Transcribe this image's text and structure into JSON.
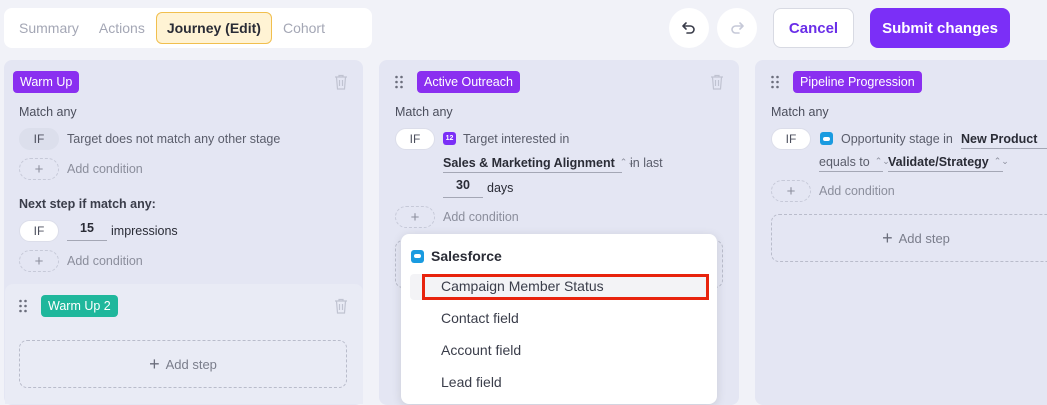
{
  "tabs": [
    "Summary",
    "Actions",
    "Journey (Edit)",
    "Cohort"
  ],
  "header": {
    "cancel": "Cancel",
    "submit": "Submit changes"
  },
  "col1": {
    "stage": "Warm Up",
    "match": "Match any",
    "if": "IF",
    "condition": "Target does not match any other stage",
    "add_condition": "Add condition",
    "next_step": "Next step if match any:",
    "impressions_value": "15",
    "impressions": "impressions",
    "add_condition_2": "Add condition",
    "sub_stage": "Warm Up 2",
    "add_step": "Add step"
  },
  "col2": {
    "stage": "Active Outreach",
    "match": "Match any",
    "if": "IF",
    "icon_text": "12",
    "condition": "Target interested in",
    "topic": "Sales & Marketing Alignment",
    "in_last": "in last",
    "days_value": "30",
    "days": "days",
    "add_condition": "Add condition"
  },
  "col3": {
    "stage": "Pipeline Progression",
    "match": "Match any",
    "if": "IF",
    "condition": "Opportunity stage in",
    "product": "New Product",
    "equals_to": "equals to",
    "value": "Validate/Strategy",
    "add_condition": "Add condition",
    "add_step": "Add step"
  },
  "dropdown": {
    "heading": "Salesforce",
    "items": [
      "Campaign Member Status",
      "Contact field",
      "Account field",
      "Lead field"
    ]
  },
  "colors": {
    "accent": "#7b2ff7",
    "teal": "#1fb79c",
    "highlight": "#e8230d"
  }
}
